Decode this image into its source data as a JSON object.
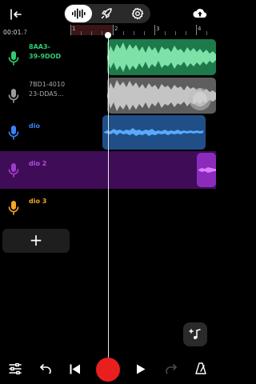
{
  "toolbar": {
    "modes": [
      {
        "name": "waveform",
        "active": true
      },
      {
        "name": "rocket",
        "active": false
      },
      {
        "name": "settings",
        "active": false
      }
    ]
  },
  "timecode": {
    "main": "00:01.",
    "fraction": "7"
  },
  "ruler": {
    "marks": [
      "1",
      "2",
      "3",
      "4"
    ]
  },
  "tracks": [
    {
      "line1": "8AA3-",
      "line2": "39-9DOD",
      "color": "#2ecc71"
    },
    {
      "line1": "7BD1-4010",
      "line2": "23-DDA5...",
      "color": "#9a9a9a"
    },
    {
      "line1": "dio",
      "line2": "",
      "color": "#3b82f6"
    },
    {
      "line1": "dio 2",
      "line2": "",
      "color": "#a03cc8"
    },
    {
      "line1": "dio 3",
      "line2": "",
      "color": "#f5a623"
    }
  ],
  "add_track": {
    "label": "+"
  },
  "colors": {
    "green_clip": "#1e7a4a",
    "gray_clip": "#6b6b6b",
    "blue_clip": "#1f4f86",
    "purple_row": "#3f0d57",
    "record": "#e81f1f"
  }
}
